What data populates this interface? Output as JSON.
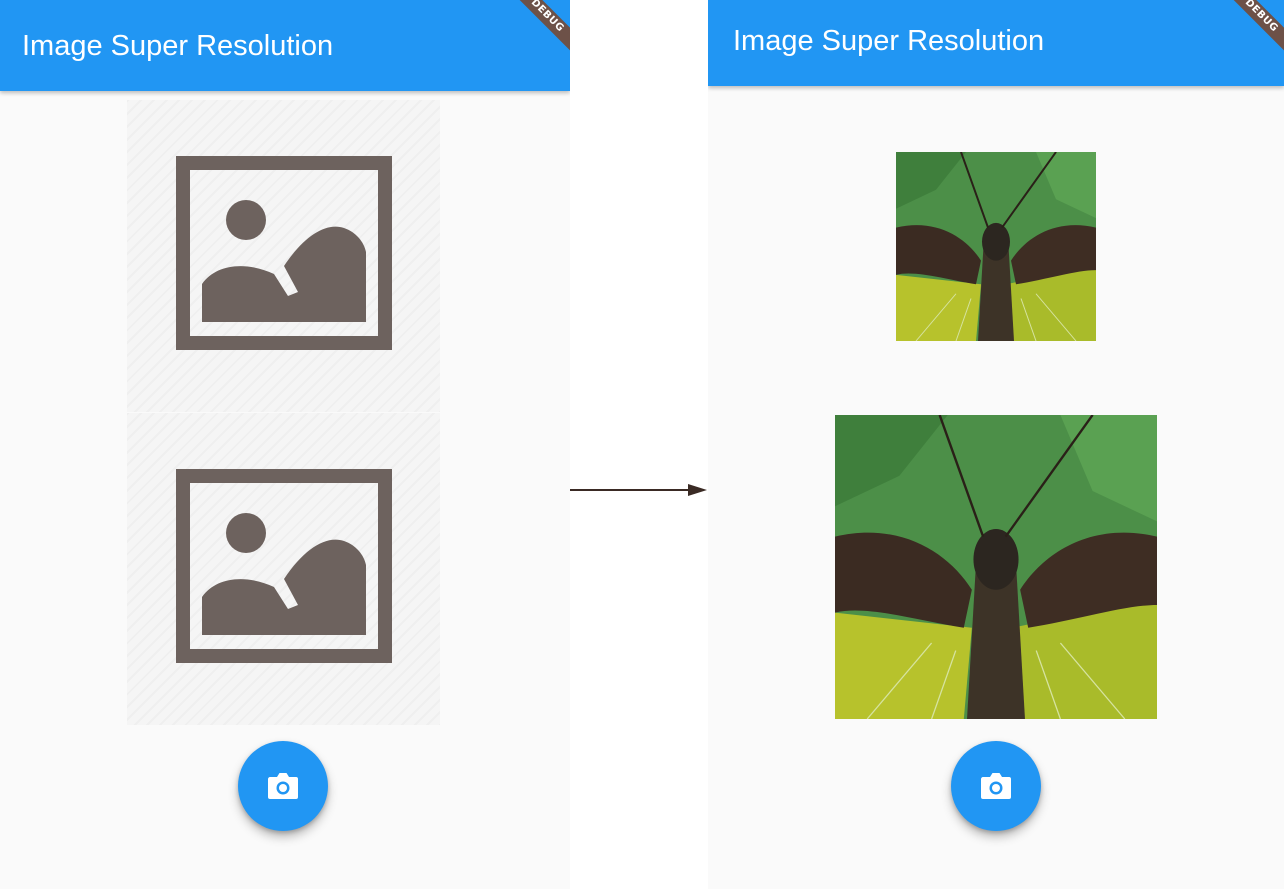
{
  "screens": {
    "left": {
      "app_title": "Image Super Resolution",
      "debug_banner": "DEBUG",
      "placeholders": [
        "image-placeholder-icon",
        "image-placeholder-icon"
      ],
      "fab_icon": "camera-icon"
    },
    "right": {
      "app_title": "Image Super Resolution",
      "debug_banner": "DEBUG",
      "images": [
        "butterfly-low-resolution",
        "butterfly-super-resolution"
      ],
      "fab_icon": "camera-icon"
    }
  },
  "colors": {
    "appbar": "#2196f3",
    "fab": "#2196f3",
    "background": "#fafafa",
    "placeholder_icon": "#6d625e",
    "debug_banner": "#6d5148",
    "arrow": "#3a2a24"
  },
  "transition_icon": "right-arrow-icon"
}
